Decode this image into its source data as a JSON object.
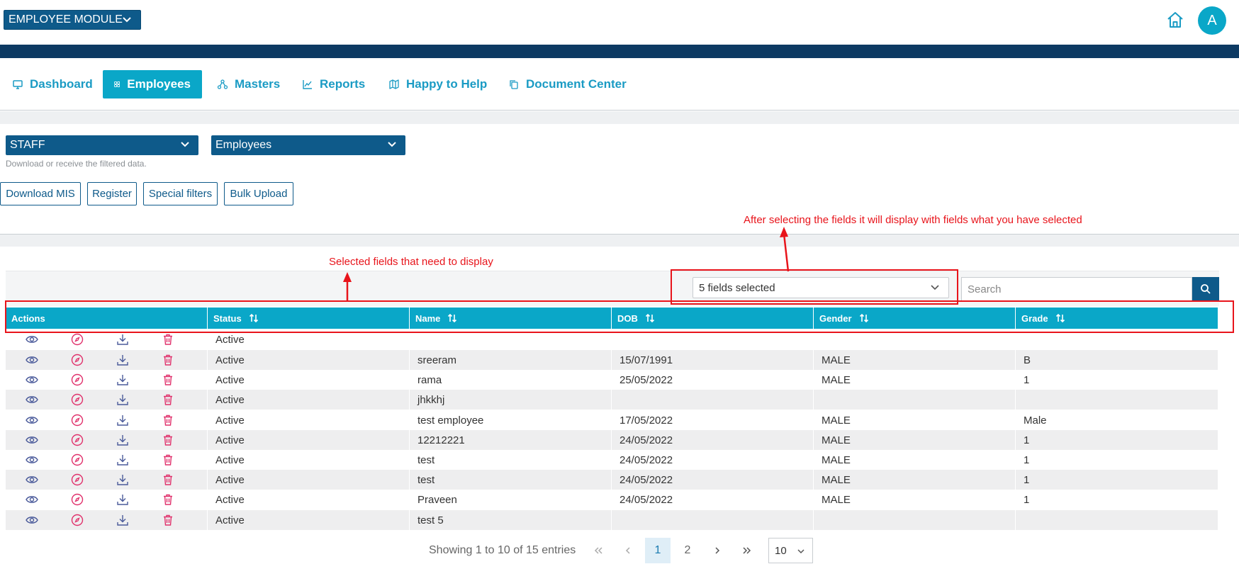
{
  "header": {
    "module_label": "EMPLOYEE MODULE",
    "avatar_letter": "A"
  },
  "nav": [
    {
      "label": "Dashboard",
      "icon": "monitor-icon"
    },
    {
      "label": "Employees",
      "icon": "grid-icon"
    },
    {
      "label": "Masters",
      "icon": "sitemap-icon"
    },
    {
      "label": "Reports",
      "icon": "chart-line-icon"
    },
    {
      "label": "Happy to Help",
      "icon": "map-icon"
    },
    {
      "label": "Document Center",
      "icon": "copy-icon"
    }
  ],
  "filters": {
    "category": "STAFF",
    "type": "Employees",
    "hint": "Download or receive the filtered data."
  },
  "buttons": {
    "download_mis": "Download MIS",
    "register": "Register",
    "special_filters": "Special filters",
    "bulk_upload": "Bulk Upload"
  },
  "table": {
    "fields_selected": "5 fields selected",
    "search_placeholder": "Search",
    "columns": [
      "Actions",
      "Status",
      "Name",
      "DOB",
      "Gender",
      "Grade"
    ],
    "rows": [
      {
        "status": "Active",
        "name": "",
        "dob": "",
        "gender": "",
        "grade": ""
      },
      {
        "status": "Active",
        "name": "sreeram",
        "dob": "15/07/1991",
        "gender": "MALE",
        "grade": "B"
      },
      {
        "status": "Active",
        "name": "rama",
        "dob": "25/05/2022",
        "gender": "MALE",
        "grade": "1"
      },
      {
        "status": "Active",
        "name": "jhkkhj",
        "dob": "",
        "gender": "",
        "grade": ""
      },
      {
        "status": "Active",
        "name": "test employee",
        "dob": "17/05/2022",
        "gender": "MALE",
        "grade": "Male"
      },
      {
        "status": "Active",
        "name": "12212221",
        "dob": "24/05/2022",
        "gender": "MALE",
        "grade": "1"
      },
      {
        "status": "Active",
        "name": "test",
        "dob": "24/05/2022",
        "gender": "MALE",
        "grade": "1"
      },
      {
        "status": "Active",
        "name": "test",
        "dob": "24/05/2022",
        "gender": "MALE",
        "grade": "1"
      },
      {
        "status": "Active",
        "name": "Praveen",
        "dob": "24/05/2022",
        "gender": "MALE",
        "grade": "1"
      },
      {
        "status": "Active",
        "name": "test 5",
        "dob": "",
        "gender": "",
        "grade": ""
      }
    ]
  },
  "pagination": {
    "summary": "Showing 1 to 10 of 15 entries",
    "pages": [
      "1",
      "2"
    ],
    "page_size": "10"
  },
  "annotations": {
    "fields_note": "After selecting the fields it will display with fields what you have selected",
    "header_note": "Selected fields that need to display"
  },
  "colors": {
    "primary_dark": "#0e5a8a",
    "accent_teal": "#0aa7c8",
    "band_navy": "#0d3a63",
    "annotation_red": "#e8141b"
  }
}
